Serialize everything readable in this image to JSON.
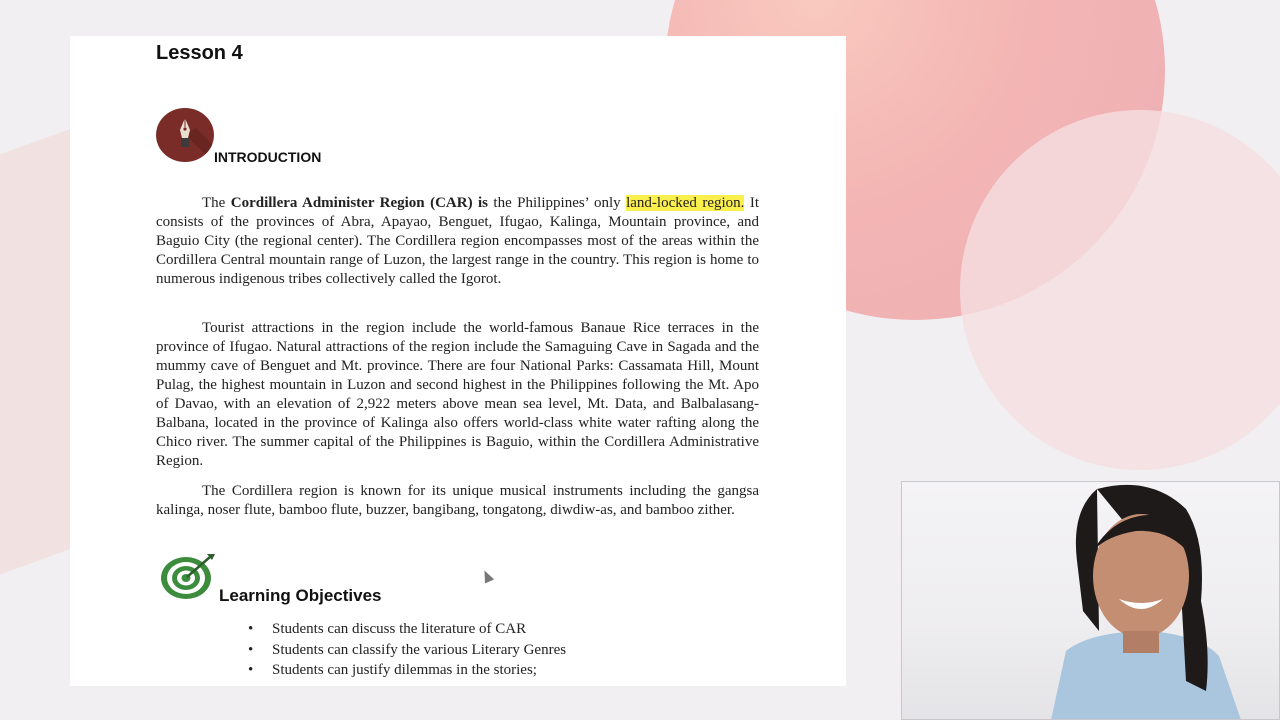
{
  "document": {
    "lesson_title": "Lesson 4",
    "intro_heading": "INTRODUCTION",
    "paragraph1": {
      "lead": "The ",
      "bold": "Cordillera Administer Region (CAR) is",
      "mid": " the Philippines’ only ",
      "highlight": "land-locked region.",
      "rest": " It consists of the provinces of Abra, Apayao, Benguet, Ifugao, Kalinga, Mountain province, and Baguio City (the regional center). The Cordillera region encompasses most of the areas within the Cordillera Central mountain range of Luzon, the largest range in the country. This region is home to numerous indigenous tribes collectively called the Igorot."
    },
    "paragraph2": "Tourist attractions in the region include the world-famous Banaue Rice terraces in the province of Ifugao. Natural attractions of the region include the Samaguing Cave in Sagada and the mummy cave of Benguet and Mt. province. There are four National Parks: Cassamata Hill, Mount Pulag, the highest mountain in Luzon and second highest in the Philippines following the Mt. Apo of Davao, with an elevation of 2,922 meters above mean sea level, Mt. Data, and Balbalasang-Balbana, located in the province of Kalinga also offers world-class white water rafting along the Chico river. The summer capital of the Philippines is Baguio, within the Cordillera Administrative Region.",
    "paragraph3": "The Cordillera region is known for its unique musical instruments including the gangsa kalinga, noser flute, bamboo flute, buzzer, bangibang, tongatong, diwdiw-as, and bamboo zither.",
    "objectives_heading": "Learning Objectives",
    "objectives": [
      "Students can discuss the literature of CAR",
      "Students can classify the various Literary Genres",
      "Students can justify dilemmas in the stories;"
    ]
  },
  "icons": {
    "intro": "fountain-pen-icon",
    "objectives": "target-icon"
  },
  "colors": {
    "highlight": "#fbef4e",
    "pen_badge": "#7a2d28",
    "target_green": "#3d8c3e"
  }
}
